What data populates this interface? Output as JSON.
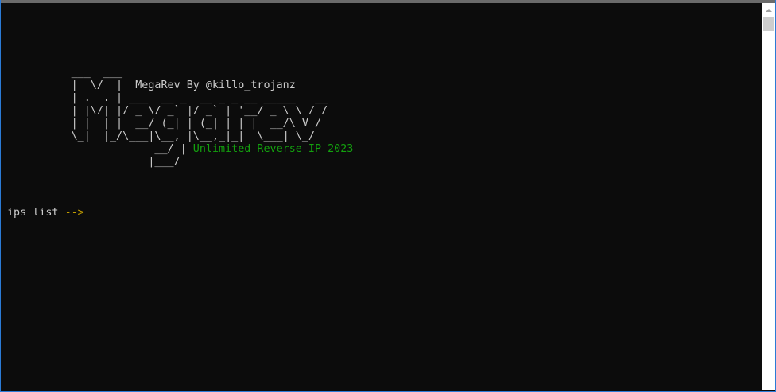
{
  "console": {
    "banner": [
      {
        "segments": [
          {
            "text": "          ___  ___ "
          }
        ]
      },
      {
        "segments": [
          {
            "text": "          |  \\/  |  MegaRev By @killo_trojanz"
          }
        ]
      },
      {
        "segments": [
          {
            "text": "          | .  . | ___  __ _  __ _ _ __ _____   __"
          }
        ]
      },
      {
        "segments": [
          {
            "text": "          | |\\/| |/ _ \\/ _` |/ _` | '__/ _ \\ \\ / /"
          }
        ]
      },
      {
        "segments": [
          {
            "text": "          | |  | |  __/ (_| | (_| | | |  __/\\ V /"
          }
        ]
      },
      {
        "segments": [
          {
            "text": "          \\_|  |_/\\___|\\__, |\\__,_|_|  \\___| \\_/"
          }
        ]
      },
      {
        "segments": [
          {
            "text": "                       __/ | "
          },
          {
            "text": "Unlimited Reverse IP 2023",
            "color": "green"
          }
        ]
      },
      {
        "segments": [
          {
            "text": "                      |___/"
          }
        ]
      }
    ],
    "prompt": {
      "label": "ips list ",
      "arrow": "-->"
    }
  },
  "colors": {
    "background": "#0c0c0c",
    "foreground": "#cccccc",
    "green": "#13a10e",
    "yellow": "#c19c00",
    "window_border": "#2b7bd6"
  },
  "icons": {
    "scroll_up": "chevron-up-icon"
  }
}
